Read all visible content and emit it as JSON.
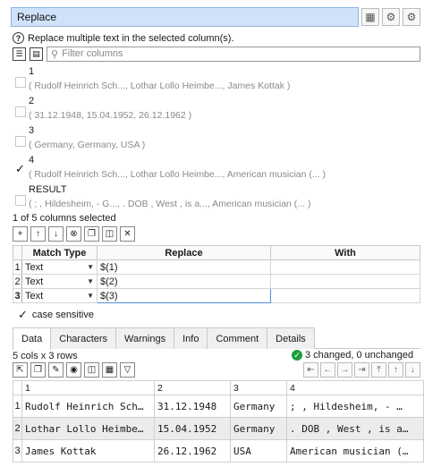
{
  "header": {
    "title": "Replace",
    "icons": [
      "transform-icon",
      "gear-icon",
      "settings-plus-icon"
    ]
  },
  "help_text": "Replace multiple text in the selected column(s).",
  "filter": {
    "placeholder": "Filter columns"
  },
  "columns": [
    {
      "name": "1",
      "values": "( Rudolf Heinrich Sch..., Lothar Lollo Heimbe..., James Kottak )",
      "checked": false
    },
    {
      "name": "2",
      "values": "( 31.12.1948, 15.04.1952, 26.12.1962 )",
      "checked": false
    },
    {
      "name": "3",
      "values": "( Germany, Germany, USA )",
      "checked": false
    },
    {
      "name": "4",
      "values": "( Rudolf Heinrich Sch..., Lothar Lollo Heimbe..., American musician (... )",
      "checked": true
    },
    {
      "name": "RESULT",
      "values": "( ; , Hildesheim, - G..., . DOB , West , is a..., American musician (... )",
      "checked": false
    }
  ],
  "selected_status": "1 of 5 columns selected",
  "replace_table": {
    "headers": [
      "Match Type",
      "Replace",
      "With"
    ],
    "rows": [
      {
        "num": "1",
        "type": "Text",
        "replace": "$(1)",
        "with": ""
      },
      {
        "num": "2",
        "type": "Text",
        "replace": "$(2)",
        "with": ""
      },
      {
        "num": "3",
        "type": "Text",
        "replace": "$(3)",
        "with": ""
      }
    ]
  },
  "case_sensitive": {
    "label": "case sensitive",
    "checked": true
  },
  "tabs": [
    "Data",
    "Characters",
    "Warnings",
    "Info",
    "Comment",
    "Details"
  ],
  "active_tab": "Data",
  "data_stats": "5 cols x 3 rows",
  "change_status": "3 changed, 0 unchanged",
  "data_table": {
    "headers": [
      "1",
      "2",
      "3",
      "4"
    ],
    "rows": [
      {
        "num": "1",
        "cells": [
          "Rudolf Heinrich Sch…",
          "31.12.1948",
          "Germany",
          "; , Hildesheim,  - …"
        ]
      },
      {
        "num": "2",
        "cells": [
          "Lothar Lollo Heimbe…",
          "15.04.1952",
          "Germany",
          ". DOB , West , is a…"
        ]
      },
      {
        "num": "3",
        "cells": [
          "James Kottak",
          "26.12.1962",
          "USA",
          "American musician (…"
        ]
      }
    ]
  },
  "colors": {
    "title_bg": "#cfe2fa",
    "title_border": "#8fb4e3",
    "check_green": "#1e9e3a",
    "shaded_row": "#ececec"
  }
}
